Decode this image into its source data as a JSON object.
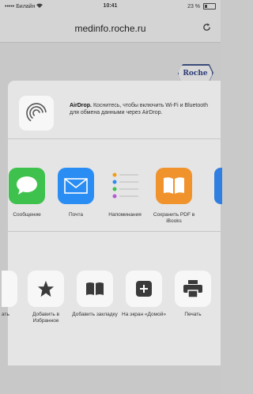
{
  "status_bar": {
    "carrier": "••••• Билайн",
    "wifi_icon": "wifi-icon",
    "time": "10:41",
    "battery": "23 %",
    "battery_level": 0.23
  },
  "url_bar": {
    "url": "medinfo.roche.ru",
    "reload_icon": "reload-icon"
  },
  "page": {
    "logo_text": "Roche"
  },
  "share_sheet": {
    "airdrop": {
      "title": "AirDrop.",
      "message": " Коснитесь, чтобы включить Wi-Fi и Bluetooth для обмена данными через AirDrop."
    },
    "apps": [
      {
        "label": "Сообщение",
        "icon": "messages-icon",
        "color": "#3ec14d"
      },
      {
        "label": "Почта",
        "icon": "mail-icon",
        "color": "#2a8df3"
      },
      {
        "label": "Напоминания",
        "icon": "reminders-icon",
        "color": "#ffffff"
      },
      {
        "label": "Сохранить PDF в iBooks",
        "icon": "ibooks-icon",
        "color": "#f0932c"
      }
    ],
    "actions": [
      {
        "label": "ать",
        "icon": "partial-action-icon"
      },
      {
        "label": "Добавить в Избранное",
        "icon": "star-icon"
      },
      {
        "label": "Добавить закладку",
        "icon": "book-icon"
      },
      {
        "label": "На экран «Домой»",
        "icon": "add-home-icon"
      },
      {
        "label": "Печать",
        "icon": "printer-icon"
      }
    ]
  }
}
